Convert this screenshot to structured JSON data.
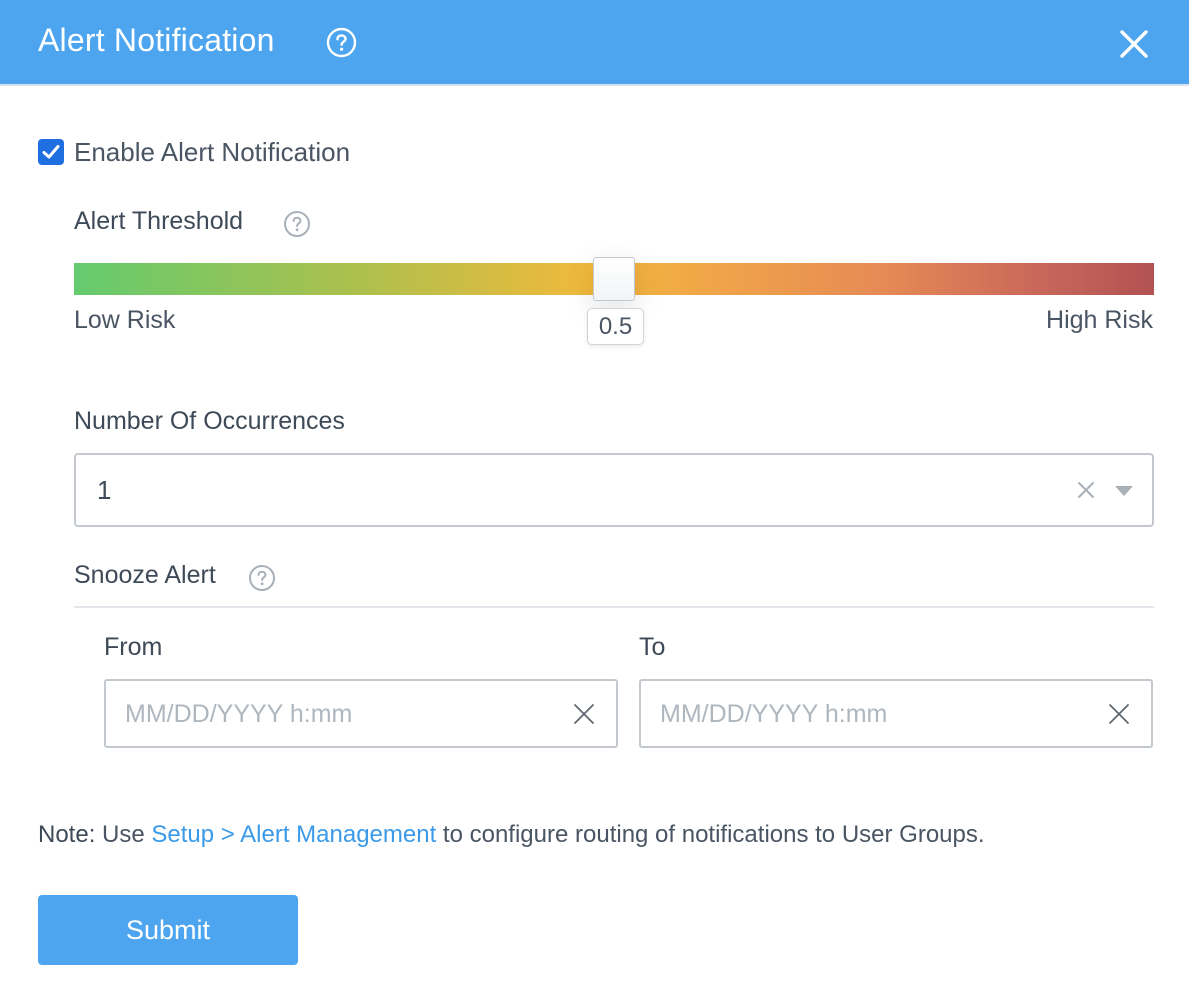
{
  "dialog": {
    "title": "Alert Notification",
    "help_icon": "question-circle-icon",
    "close_icon": "close-icon"
  },
  "enable": {
    "label": "Enable Alert Notification",
    "checked": true
  },
  "threshold": {
    "label": "Alert Threshold",
    "help_icon": "question-circle-icon",
    "value": "0.5",
    "min_label": "Low Risk",
    "max_label": "High Risk"
  },
  "occurrences": {
    "label": "Number Of Occurrences",
    "value": "1",
    "clear_icon": "close-icon",
    "caret_icon": "chevron-down-icon"
  },
  "snooze": {
    "label": "Snooze Alert",
    "help_icon": "question-circle-icon",
    "from_label": "From",
    "from_placeholder": "MM/DD/YYYY h:mm",
    "to_label": "To",
    "to_placeholder": "MM/DD/YYYY h:mm"
  },
  "note": {
    "bold": "Note:",
    "prefix": " Use ",
    "link": "Setup > Alert Management",
    "suffix": " to configure routing of notifications to User Groups."
  },
  "submit_label": "Submit",
  "colors": {
    "header": "#4da5ef",
    "checkbox": "#1f6fe0",
    "link": "#3b9ae8",
    "button": "#4da5ef"
  }
}
